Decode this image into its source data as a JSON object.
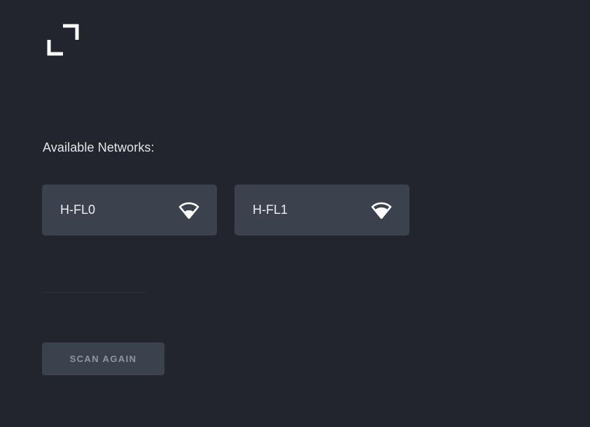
{
  "header": {
    "logo_icon": "corner-brackets-logo-icon"
  },
  "networks_section": {
    "label": "Available Networks:",
    "networks": [
      {
        "name": "H-FL0",
        "icon": "wifi-signal-medium-icon"
      },
      {
        "name": "H-FL1",
        "icon": "wifi-signal-full-icon"
      }
    ]
  },
  "actions": {
    "scan_again_label": "SCAN AGAIN"
  },
  "colors": {
    "background": "#22252d",
    "card": "#3c424d",
    "text": "#eef0f3",
    "button_text": "#8d96a3"
  }
}
